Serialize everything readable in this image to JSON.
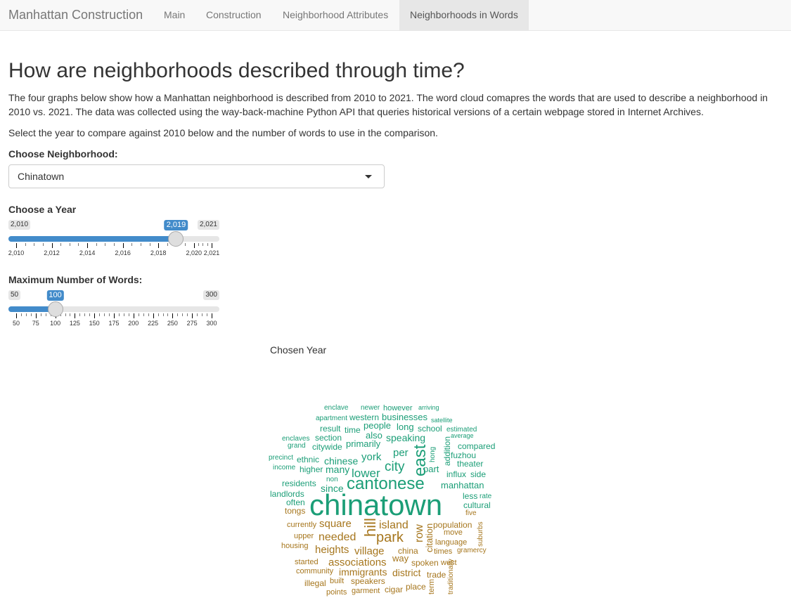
{
  "navbar": {
    "brand": "Manhattan Construction",
    "tabs": [
      {
        "label": "Main"
      },
      {
        "label": "Construction"
      },
      {
        "label": "Neighborhood Attributes"
      },
      {
        "label": "Neighborhoods in Words",
        "active": true
      }
    ]
  },
  "main": {
    "title": "How are neighborhoods described through time?",
    "description": "The four graphs below show how a Manhattan neighborhood is described from 2010 to 2021. The word cloud comapres the words that are used to describe a neighborhood in 2010 vs. 2021. The data was collected using the way-back-machine Python API that queries historical versions of a certain webpage stored in Internet Archives.",
    "instructions": "Select the year to compare against 2010 below and the number of words to use in the comparison."
  },
  "neighborhood_select": {
    "label": "Choose Neighborhood:",
    "value": "Chinatown"
  },
  "year_slider": {
    "label": "Choose a Year",
    "min_label": "2,010",
    "max_label": "2,021",
    "value_label": "2,019",
    "min": 2010,
    "max": 2021,
    "value": 2019,
    "tick_labels": [
      "2,010",
      "2,012",
      "2,014",
      "2,016",
      "2,018",
      "2,020",
      "2,021"
    ]
  },
  "words_slider": {
    "label": "Maximum Number of Words:",
    "min_label": "50",
    "max_label": "300",
    "value_label": "100",
    "min": 50,
    "max": 300,
    "value": 100,
    "tick_labels": [
      "50",
      "75",
      "100",
      "125",
      "150",
      "175",
      "200",
      "225",
      "250",
      "275",
      "300"
    ]
  },
  "word_cloud": {
    "title": "Chosen Year",
    "colors": {
      "green": "#1b9e77",
      "orange": "#a6761d"
    },
    "words": [
      "enclave",
      "newer",
      "however",
      "arriving",
      "apartment",
      "western",
      "businesses",
      "satellite",
      "result",
      "time",
      "people",
      "long",
      "school",
      "estimated",
      "enclaves",
      "section",
      "also",
      "speaking",
      "average",
      "grand",
      "citywide",
      "primarily",
      "compared",
      "hong",
      "addition",
      "precinct",
      "ethnic",
      "chinese",
      "york",
      "per",
      "east",
      "fuzhou",
      "income",
      "higher",
      "many",
      "city",
      "theater",
      "lower",
      "part",
      "influx",
      "side",
      "non",
      "residents",
      "since",
      "cantonese",
      "manhattan",
      "landlords",
      "chinatown",
      "less",
      "rate",
      "often",
      "cultural",
      "tongs",
      "five",
      "currently",
      "square",
      "hill",
      "island",
      "population",
      "suburbs",
      "upper",
      "needed",
      "park",
      "row",
      "move",
      "citation",
      "housing",
      "language",
      "heights",
      "village",
      "china",
      "times",
      "gramercy",
      "way",
      "started",
      "associations",
      "spoken",
      "west",
      "community",
      "immigrants",
      "district",
      "trade",
      "illegal",
      "built",
      "speakers",
      "points",
      "garment",
      "cigar",
      "place",
      "term",
      "traditionally"
    ]
  }
}
